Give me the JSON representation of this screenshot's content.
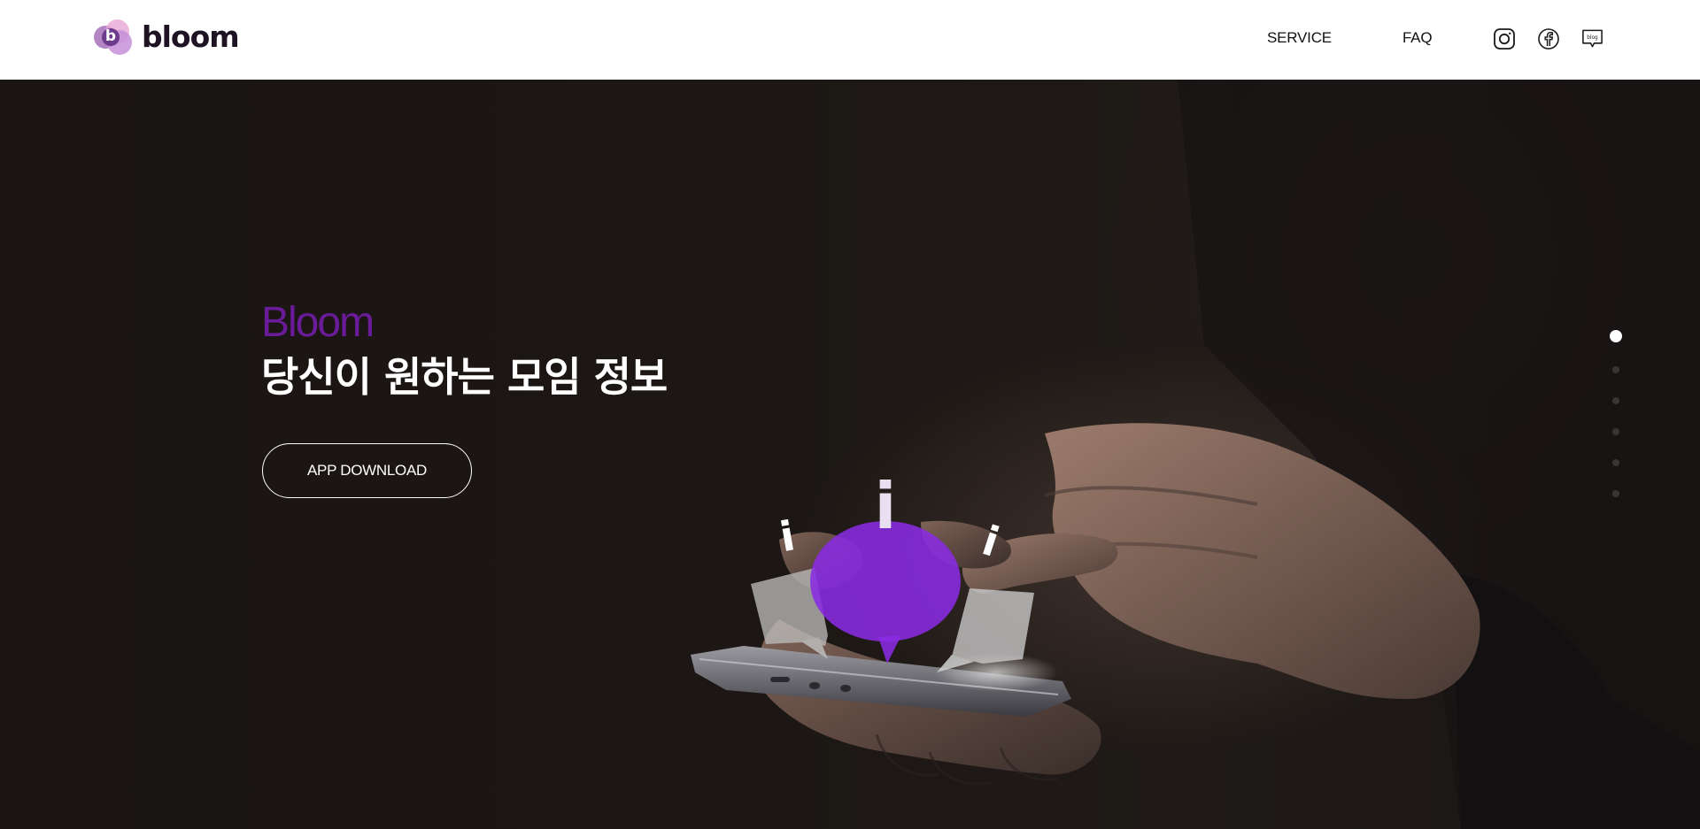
{
  "header": {
    "logo_text": "bloom",
    "logo_mark_letter": "b",
    "nav": [
      {
        "label": "SERVICE"
      },
      {
        "label": "FAQ"
      }
    ],
    "social": [
      {
        "icon": "instagram-icon"
      },
      {
        "icon": "facebook-icon"
      },
      {
        "icon": "blog-icon",
        "label": "blog"
      }
    ]
  },
  "hero": {
    "title": "Bloom",
    "subtitle": "당신이 원하는 모임 정보",
    "cta_label": "APP DOWNLOAD",
    "bubble_glyph": "i",
    "slides": {
      "count": 6,
      "active": 1
    }
  },
  "colors": {
    "brand_purple": "#6a1b9a",
    "bubble_purple": "#8a2be2",
    "hero_bg": "#1c1714"
  }
}
